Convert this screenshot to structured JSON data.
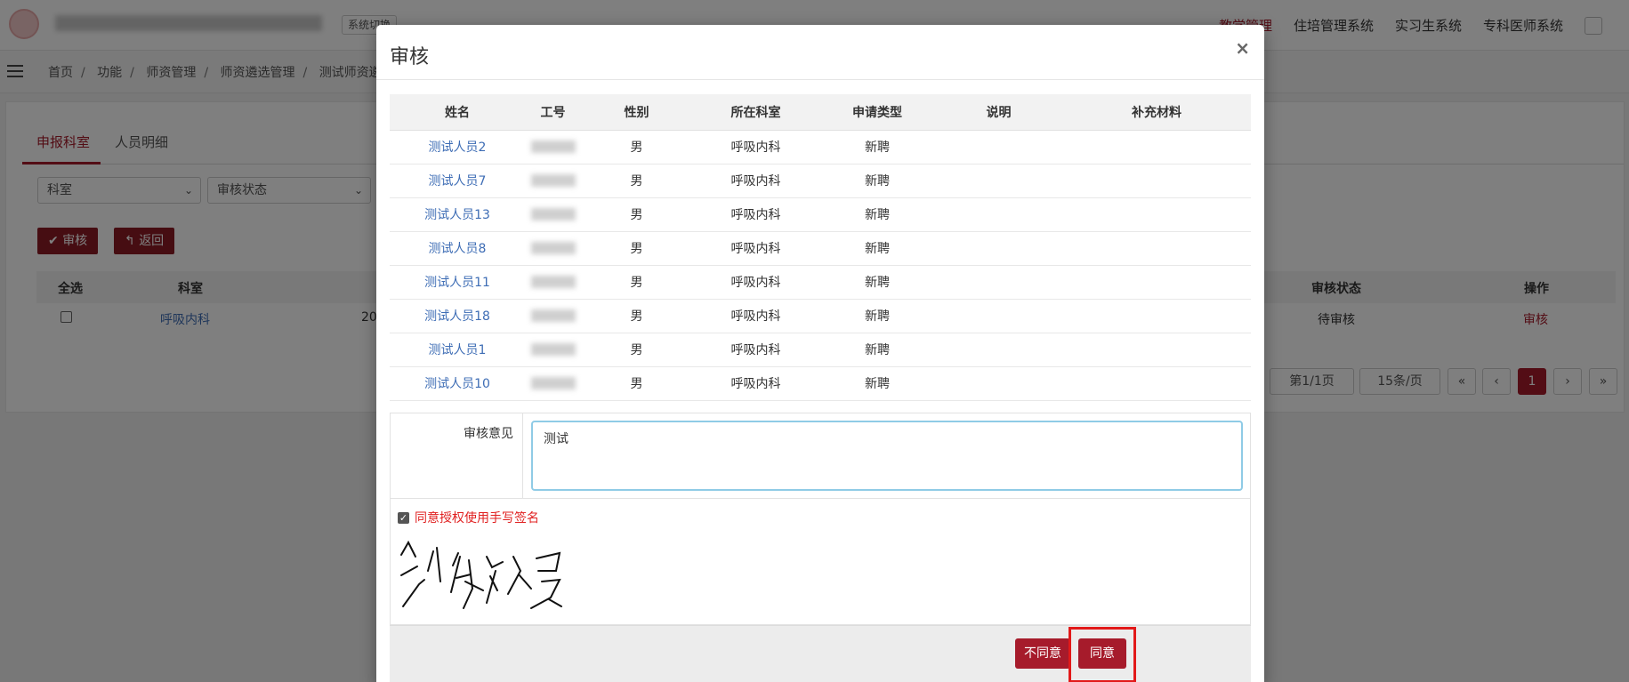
{
  "header": {
    "system_switch": "系统切换",
    "nav": [
      "教学管理",
      "住培管理系统",
      "实习生系统",
      "专科医师系统"
    ],
    "active_nav_index": 0
  },
  "breadcrumb": [
    "首页",
    "功能",
    "师资管理",
    "师资遴选管理",
    "测试师资遴选"
  ],
  "page": {
    "tabs": [
      "申报科室",
      "人员明细"
    ],
    "filters": {
      "department": "科室",
      "status": "审核状态"
    },
    "buttons": {
      "review": "审核",
      "back": "返回"
    },
    "table_headers": {
      "select_all": "全选",
      "department": "科室",
      "review_status": "审核状态",
      "action": "操作"
    },
    "row": {
      "department": "呼吸内科",
      "date_prefix": "20",
      "status": "待审核",
      "action": "审核"
    },
    "pager": {
      "page": "第1/1页",
      "per_page": "15条/页",
      "current": "1",
      "first": "«",
      "prev": "‹",
      "next": "›",
      "last": "»"
    }
  },
  "modal": {
    "title": "审核",
    "close": "×",
    "columns": [
      "姓名",
      "工号",
      "性别",
      "所在科室",
      "申请类型",
      "说明",
      "补充材料"
    ],
    "rows": [
      {
        "name": "测试人员2",
        "gender": "男",
        "dept": "呼吸内科",
        "type": "新聘"
      },
      {
        "name": "测试人员7",
        "gender": "男",
        "dept": "呼吸内科",
        "type": "新聘"
      },
      {
        "name": "测试人员13",
        "gender": "男",
        "dept": "呼吸内科",
        "type": "新聘"
      },
      {
        "name": "测试人员8",
        "gender": "男",
        "dept": "呼吸内科",
        "type": "新聘"
      },
      {
        "name": "测试人员11",
        "gender": "男",
        "dept": "呼吸内科",
        "type": "新聘"
      },
      {
        "name": "测试人员18",
        "gender": "男",
        "dept": "呼吸内科",
        "type": "新聘"
      },
      {
        "name": "测试人员1",
        "gender": "男",
        "dept": "呼吸内科",
        "type": "新聘"
      },
      {
        "name": "测试人员10",
        "gender": "男",
        "dept": "呼吸内科",
        "type": "新聘"
      }
    ],
    "review_label": "审核意见",
    "review_value": "测试",
    "consent_label": "同意授权使用手写签名",
    "signature_text": "测试人员",
    "reject_label": "不同意",
    "approve_label": "同意"
  },
  "colors": {
    "brand": "#a61b2b",
    "link": "#3e6db5",
    "consent": "#e02020",
    "highlight": "#e21919"
  }
}
